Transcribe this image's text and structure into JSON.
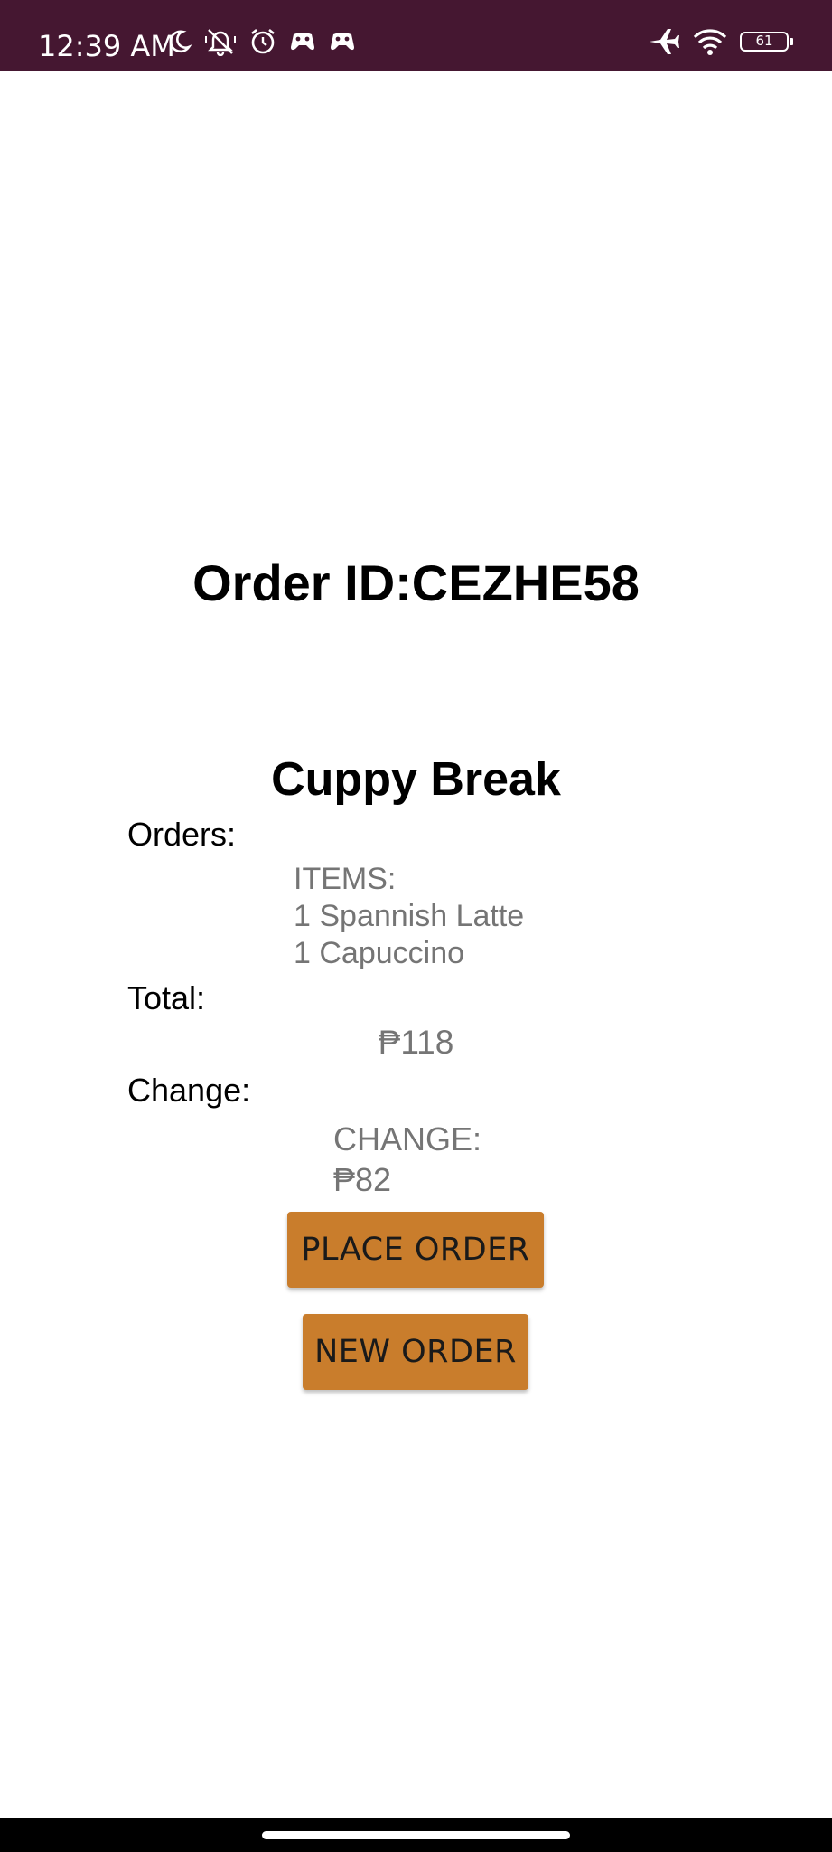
{
  "status_bar": {
    "time": "12:39 AM",
    "battery_level": "61",
    "left_icons": [
      "moon-icon",
      "bell-off-icon",
      "alarm-icon",
      "game-controller-icon",
      "game-controller-icon"
    ],
    "right_icons": [
      "airplane-icon",
      "wifi-icon",
      "battery-icon"
    ],
    "background_color": "#451731"
  },
  "order": {
    "id_text": "Order ID:CEZHE58",
    "shop_name": "Cuppy Break"
  },
  "labels": {
    "orders": "Orders:",
    "total": "Total:",
    "change": "Change:"
  },
  "items": {
    "header": "ITEMS:",
    "lines": [
      "1 Spannish Latte",
      "1 Capuccino"
    ]
  },
  "total": {
    "value": "₱118"
  },
  "change": {
    "header": "CHANGE:",
    "value": "₱82"
  },
  "buttons": {
    "place_order": "PLACE ORDER",
    "new_order": "NEW ORDER",
    "color": "#c97d2c"
  }
}
